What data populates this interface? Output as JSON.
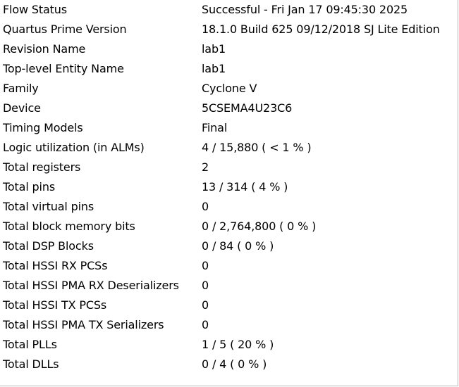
{
  "flow_summary": {
    "rows": [
      {
        "key": "Flow Status",
        "value": "Successful - Fri Jan 17 09:45:30 2025"
      },
      {
        "key": "Quartus Prime Version",
        "value": "18.1.0 Build 625 09/12/2018 SJ Lite Edition"
      },
      {
        "key": "Revision Name",
        "value": "lab1"
      },
      {
        "key": "Top-level Entity Name",
        "value": "lab1"
      },
      {
        "key": "Family",
        "value": "Cyclone V"
      },
      {
        "key": "Device",
        "value": "5CSEMA4U23C6"
      },
      {
        "key": "Timing Models",
        "value": "Final"
      },
      {
        "key": "Logic utilization (in ALMs)",
        "value": "4 / 15,880 ( < 1 % )"
      },
      {
        "key": "Total registers",
        "value": "2"
      },
      {
        "key": "Total pins",
        "value": "13 / 314 ( 4 % )"
      },
      {
        "key": "Total virtual pins",
        "value": "0"
      },
      {
        "key": "Total block memory bits",
        "value": "0 / 2,764,800 ( 0 % )"
      },
      {
        "key": "Total DSP Blocks",
        "value": "0 / 84 ( 0 % )"
      },
      {
        "key": "Total HSSI RX PCSs",
        "value": "0"
      },
      {
        "key": "Total HSSI PMA RX Deserializers",
        "value": "0"
      },
      {
        "key": "Total HSSI TX PCSs",
        "value": "0"
      },
      {
        "key": "Total HSSI PMA TX Serializers",
        "value": "0"
      },
      {
        "key": "Total PLLs",
        "value": "1 / 5 ( 20 % )"
      },
      {
        "key": "Total DLLs",
        "value": "0 / 4 ( 0 % )"
      }
    ]
  }
}
